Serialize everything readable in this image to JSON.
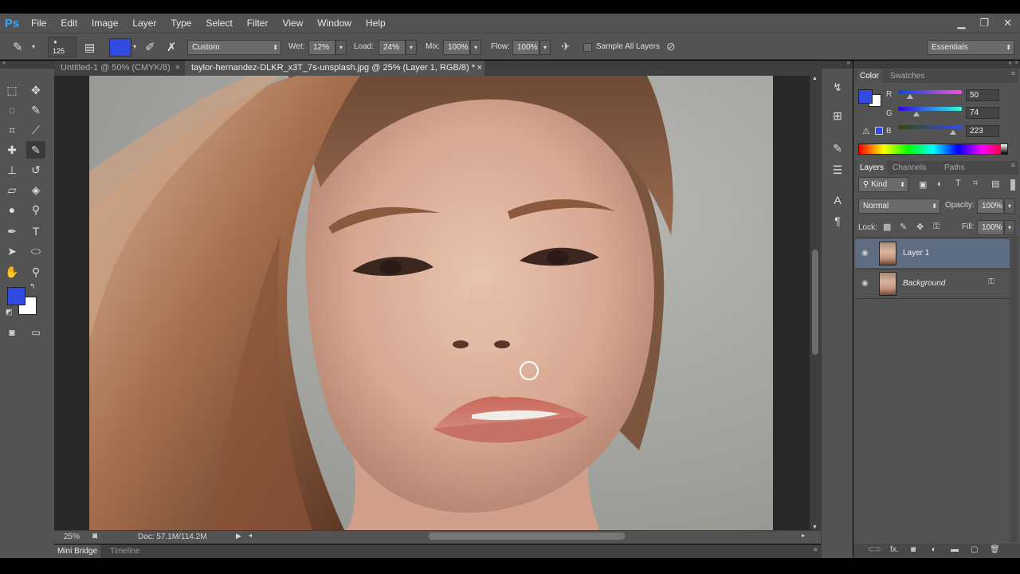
{
  "app": {
    "logo": "Ps"
  },
  "menu": [
    "File",
    "Edit",
    "Image",
    "Layer",
    "Type",
    "Select",
    "Filter",
    "View",
    "Window",
    "Help"
  ],
  "window_controls": [
    "▁",
    "❐",
    "✕"
  ],
  "options": {
    "brush_size": "125",
    "preset": "Custom",
    "wet_label": "Wet:",
    "wet": "12%",
    "load_label": "Load:",
    "load": "24%",
    "mix_label": "Mix:",
    "mix": "100%",
    "flow_label": "Flow:",
    "flow": "100%",
    "sample_all_layers": "Sample All Layers",
    "workspace": "Essentials",
    "foreground_color": "#324ADF"
  },
  "tabs": [
    {
      "label": "Untitled-1 @ 50% (CMYK/8)",
      "close": "×"
    },
    {
      "label": "taylor-hernandez-DLKR_x3T_7s-unsplash.jpg @ 25% (Layer 1, RGB/8) *",
      "close": "×"
    }
  ],
  "status": {
    "zoom": "25%",
    "doc": "Doc: 57.1M/114.2M"
  },
  "bottom_tabs": [
    "Mini Bridge",
    "Timeline"
  ],
  "color_panel": {
    "tabs": [
      "Color",
      "Swatches"
    ],
    "r_label": "R",
    "r": "50",
    "g_label": "G",
    "g": "74",
    "b_label": "B",
    "b": "223"
  },
  "layers_panel": {
    "tabs": [
      "Layers",
      "Channels",
      "Paths"
    ],
    "filter": "Kind",
    "blend_mode": "Normal",
    "opacity_label": "Opacity:",
    "opacity": "100%",
    "lock_label": "Lock:",
    "fill_label": "Fill:",
    "fill": "100%",
    "layers": [
      {
        "name": "Layer 1",
        "selected": true
      },
      {
        "name": "Background",
        "locked": true
      }
    ]
  }
}
